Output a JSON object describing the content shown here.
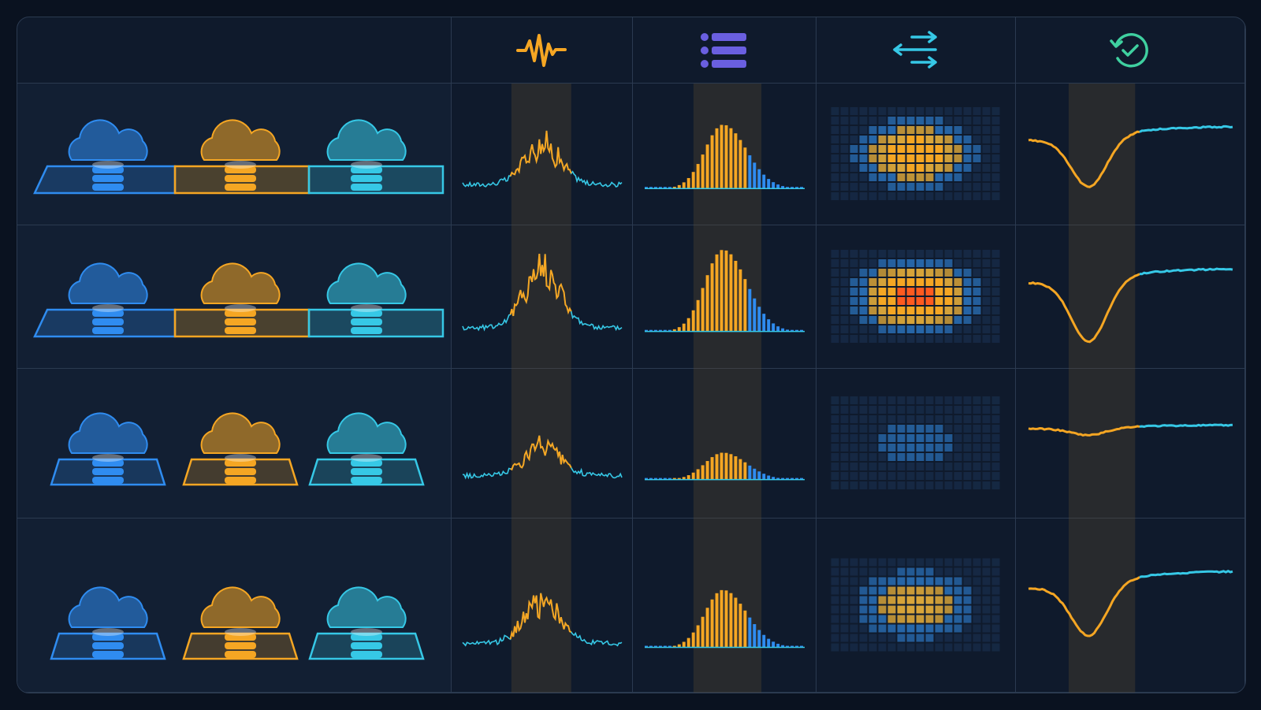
{
  "colors": {
    "background": "#0a1220",
    "panel": "#0f1a2c",
    "grid_line": "#2b3a50",
    "blue": "#2f8cf0",
    "orange": "#f5a623",
    "cyan": "#36c8e6",
    "purple": "#6a5fe0",
    "teal": "#3fd0a0"
  },
  "header": {
    "icons": [
      "waveform-icon",
      "list-icon",
      "bidirectional-arrows-icon",
      "refresh-check-icon"
    ]
  },
  "rows": [
    {
      "platform": "shared",
      "signal_level": 0.65,
      "histogram_level": 0.75,
      "heatmap_intensity": 0.75,
      "curve_dip": 0.6
    },
    {
      "platform": "shared",
      "signal_level": 0.95,
      "histogram_level": 0.95,
      "heatmap_intensity": 1.0,
      "curve_dip": 0.75
    },
    {
      "platform": "separate",
      "signal_level": 0.45,
      "histogram_level": 0.3,
      "heatmap_intensity": 0.2,
      "curve_dip": 0.08
    },
    {
      "platform": "separate",
      "signal_level": 0.55,
      "histogram_level": 0.55,
      "heatmap_intensity": 0.55,
      "curve_dip": 0.5
    }
  ]
}
